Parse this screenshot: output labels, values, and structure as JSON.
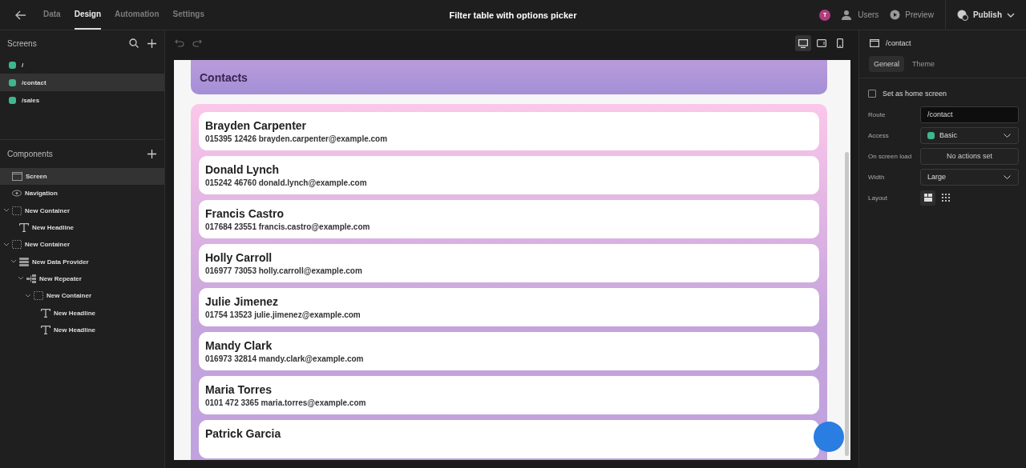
{
  "top_bar": {
    "tabs": [
      {
        "label": "Data",
        "selected": false
      },
      {
        "label": "Design",
        "selected": true
      },
      {
        "label": "Automation",
        "selected": false
      },
      {
        "label": "Settings",
        "selected": false
      }
    ],
    "title": "Filter table with options picker",
    "avatar": "T",
    "users": "Users",
    "preview": "Preview",
    "publish": "Publish"
  },
  "screens": {
    "title": "Screens",
    "items": [
      {
        "label": "/",
        "color": "#3fb68e",
        "selected": false
      },
      {
        "label": "/contact",
        "color": "#3fb68e",
        "selected": true
      },
      {
        "label": "/sales",
        "color": "#3fb68e",
        "selected": false
      }
    ]
  },
  "components": {
    "title": "Components",
    "tree": [
      {
        "label": "Screen",
        "kind": "screen",
        "selected": true
      },
      {
        "label": "Navigation",
        "kind": "navigation",
        "selected": false
      },
      {
        "label": "New Container",
        "kind": "container",
        "selected": false,
        "expanded": true,
        "children": [
          {
            "label": "New Headline",
            "kind": "headline",
            "selected": false
          }
        ]
      },
      {
        "label": "New Container",
        "kind": "container",
        "selected": false,
        "expanded": true,
        "children": [
          {
            "label": "New Data Provider",
            "kind": "data-provider",
            "selected": false,
            "expanded": true,
            "children": [
              {
                "label": "New Repeater",
                "kind": "repeater",
                "selected": false,
                "expanded": true,
                "children": [
                  {
                    "label": "New Container",
                    "kind": "container",
                    "selected": false,
                    "expanded": true,
                    "children": [
                      {
                        "label": "New Headline",
                        "kind": "headline",
                        "selected": false
                      },
                      {
                        "label": "New Headline",
                        "kind": "headline",
                        "selected": false
                      }
                    ]
                  }
                ]
              }
            ]
          }
        ]
      }
    ]
  },
  "canvas": {
    "devices": [
      {
        "kind": "desktop",
        "selected": true
      },
      {
        "kind": "tablet",
        "selected": false
      },
      {
        "kind": "mobile",
        "selected": false
      }
    ],
    "heading": "Contacts",
    "contacts": [
      {
        "name": "Brayden Carpenter",
        "detail": "015395 12426 brayden.carpenter@example.com"
      },
      {
        "name": "Donald Lynch",
        "detail": "015242 46760 donald.lynch@example.com"
      },
      {
        "name": "Francis Castro",
        "detail": "017684 23551 francis.castro@example.com"
      },
      {
        "name": "Holly Carroll",
        "detail": "016977 73053 holly.carroll@example.com"
      },
      {
        "name": "Julie Jimenez",
        "detail": "01754 13523 julie.jimenez@example.com"
      },
      {
        "name": "Mandy Clark",
        "detail": "016973 32814 mandy.clark@example.com"
      },
      {
        "name": "Maria Torres",
        "detail": "0101 472 3365 maria.torres@example.com"
      },
      {
        "name": "Patrick Garcia"
      }
    ]
  },
  "settings": {
    "screen": "/contact",
    "tabs": [
      {
        "label": "General",
        "selected": true
      },
      {
        "label": "Theme",
        "selected": false
      }
    ],
    "home_screen": {
      "label": "Set as home screen",
      "checked": false
    },
    "route": {
      "label": "Route",
      "value": "/contact"
    },
    "access": {
      "label": "Access",
      "value": "Basic",
      "color": "#3fb68e"
    },
    "on_load": {
      "label": "On screen load",
      "value": "No actions set"
    },
    "width": {
      "label": "Width",
      "value": "Large"
    },
    "layout": {
      "label": "Layout",
      "options": [
        {
          "kind": "blocks",
          "selected": true
        },
        {
          "kind": "grid",
          "selected": false
        }
      ]
    }
  }
}
